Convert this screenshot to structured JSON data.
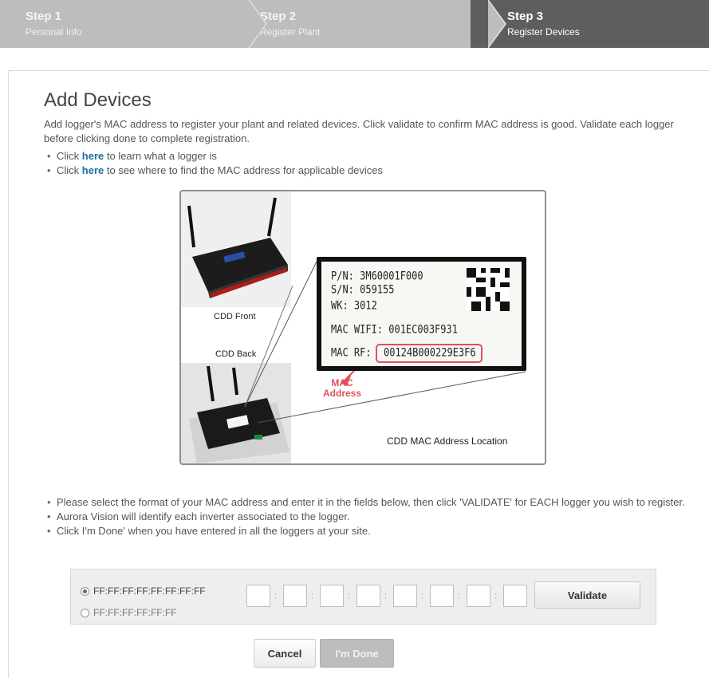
{
  "steps": [
    {
      "num": "Step 1",
      "sub": "Personal Info"
    },
    {
      "num": "Step 2",
      "sub": "Register Plant"
    },
    {
      "num": "Step 3",
      "sub": "Register Devices"
    }
  ],
  "page": {
    "title": "Add Devices",
    "intro": "Add logger's MAC address to register your plant and related devices. Click validate to confirm MAC address is good. Validate each logger before clicking done to complete registration.",
    "links": [
      {
        "pre": "Click ",
        "link": "here",
        "post": " to learn what a logger is"
      },
      {
        "pre": "Click ",
        "link": "here",
        "post": " to see where to find the MAC address for applicable devices"
      }
    ]
  },
  "image": {
    "cap_front": "CDD Front",
    "cap_back": "CDD Back",
    "cap_location": "CDD MAC Address Location",
    "label_lines": {
      "pn": "P/N: 3M60001F000",
      "sn": "S/N:  059155",
      "wk": "WK: 3012",
      "wifi": "MAC WIFI: 001EC003F931",
      "rf_label": "MAC RF:",
      "rf_value": "00124B000229E3F6"
    },
    "callout_line1": "MAC",
    "callout_line2": "Address"
  },
  "instructions": [
    "Please select the format of your MAC address and enter it in the fields below, then click 'VALIDATE' for EACH logger you wish to register.",
    "Aurora Vision will identify each inverter associated to the logger.",
    "Click I'm Done' when you have entered in all the loggers at your site."
  ],
  "form": {
    "format_options": [
      "FF:FF:FF:FF:FF:FF:FF:FF",
      "FF:FF:FF:FF:FF:FF"
    ],
    "selected_format": "FF:FF:FF:FF:FF:FF:FF:FF",
    "separator": ":",
    "fields": [
      "",
      "",
      "",
      "",
      "",
      "",
      "",
      ""
    ],
    "validate_label": "Validate"
  },
  "buttons": {
    "cancel": "Cancel",
    "done": "I'm Done"
  },
  "colors": {
    "link": "#1a6fa8",
    "active_step": "#5e5e5e",
    "inactive_step": "#bdbdbd",
    "callout": "#e0505a"
  }
}
